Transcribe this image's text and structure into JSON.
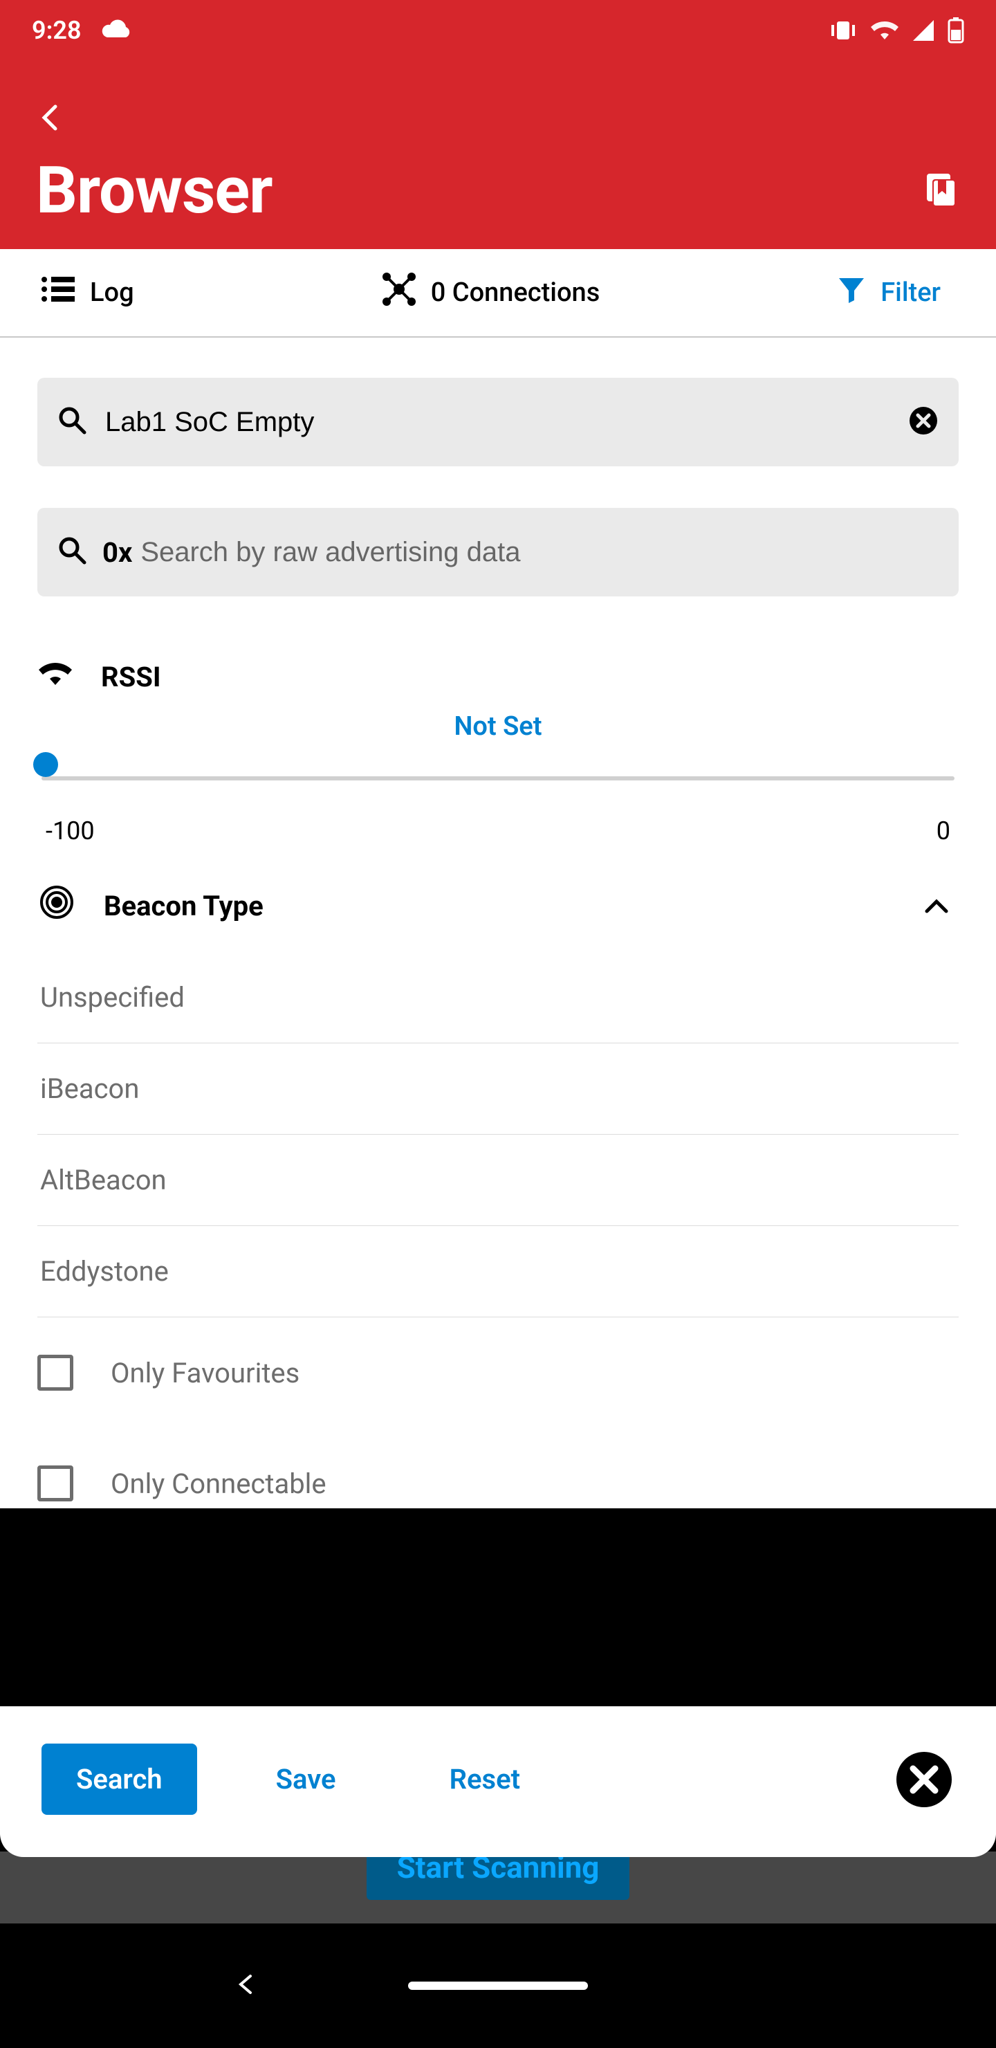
{
  "status": {
    "time": "9:28"
  },
  "header": {
    "title": "Browser"
  },
  "tabs": {
    "log": "Log",
    "connections": "0 Connections",
    "filter": "Filter"
  },
  "filter": {
    "name_value": "Lab1 SoC Empty",
    "raw_prefix": "0x",
    "raw_placeholder": "Search by raw advertising data",
    "rssi_label": "RSSI",
    "rssi_value_text": "Not Set",
    "rssi_min": "-100",
    "rssi_max": "0",
    "beacon_label": "Beacon Type",
    "beacon_types": {
      "0": "Unspecified",
      "1": "iBeacon",
      "2": "AltBeacon",
      "3": "Eddystone"
    },
    "only_favourites": "Only Favourites",
    "only_connectable": "Only Connectable"
  },
  "actions": {
    "search": "Search",
    "save": "Save",
    "reset": "Reset"
  },
  "behind": {
    "start_scanning": "Start Scanning"
  }
}
